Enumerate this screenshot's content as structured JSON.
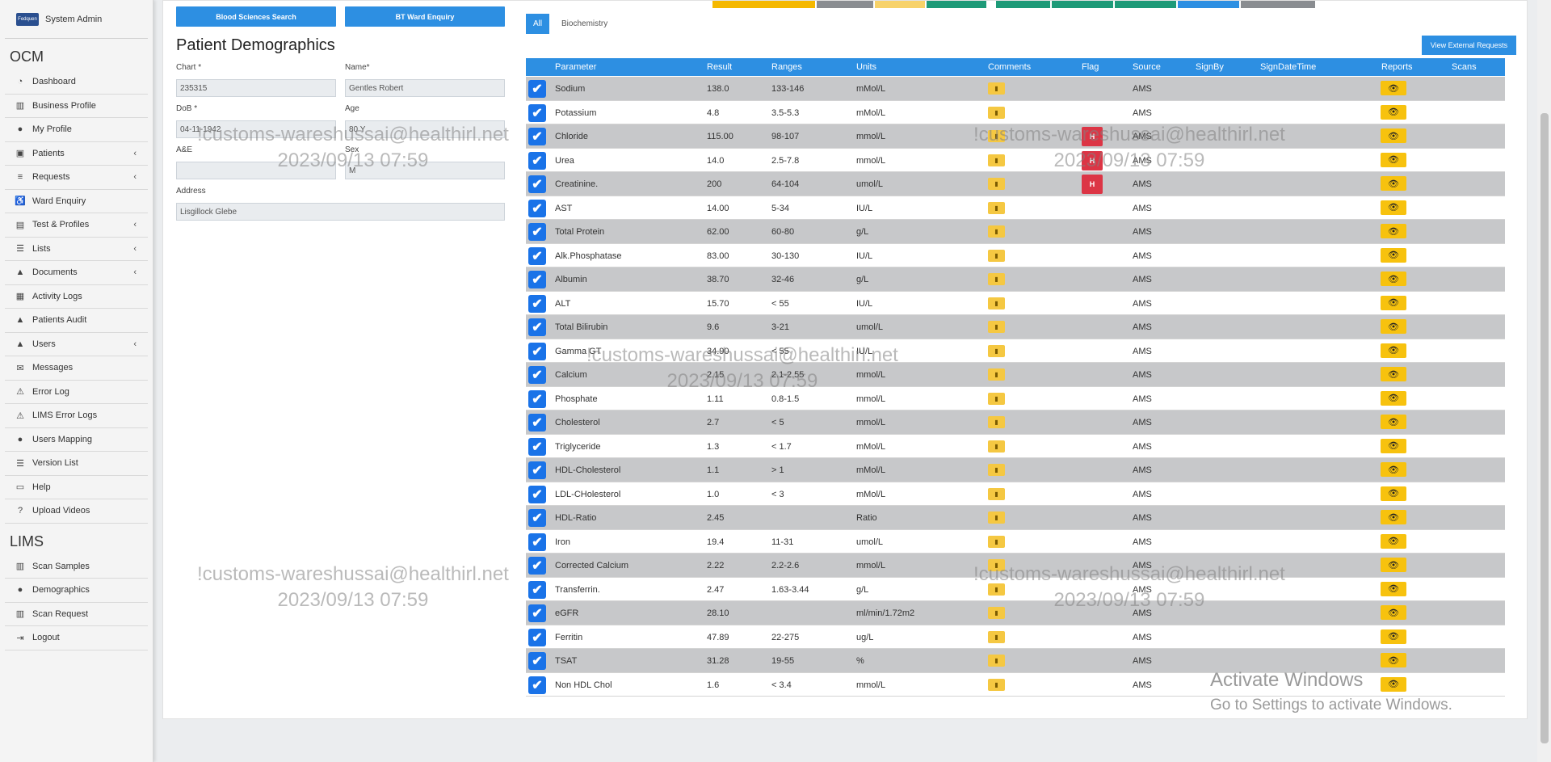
{
  "sidebar": {
    "user": "System Admin",
    "logo_text": "Fedquen",
    "sections": [
      {
        "title": "OCM",
        "items": [
          {
            "label": "Dashboard",
            "icon": "◔",
            "chevron": false
          },
          {
            "label": "Business Profile",
            "icon": "▥",
            "chevron": false
          },
          {
            "label": "My Profile",
            "icon": "●",
            "chevron": false
          },
          {
            "label": "Patients",
            "icon": "▣",
            "chevron": true
          },
          {
            "label": "Requests",
            "icon": "≡",
            "chevron": true
          },
          {
            "label": "Ward Enquiry",
            "icon": "♿",
            "chevron": false
          },
          {
            "label": "Test & Profiles",
            "icon": "▤",
            "chevron": true
          },
          {
            "label": "Lists",
            "icon": "☰",
            "chevron": true
          },
          {
            "label": "Documents",
            "icon": "▲",
            "chevron": true
          },
          {
            "label": "Activity Logs",
            "icon": "▦",
            "chevron": false
          },
          {
            "label": "Patients Audit",
            "icon": "▲",
            "chevron": false
          },
          {
            "label": "Users",
            "icon": "▲",
            "chevron": true
          },
          {
            "label": "Messages",
            "icon": "✉",
            "chevron": false
          },
          {
            "label": "Error Log",
            "icon": "⚠",
            "chevron": false
          },
          {
            "label": "LIMS Error Logs",
            "icon": "⚠",
            "chevron": false
          },
          {
            "label": "Users Mapping",
            "icon": "●",
            "chevron": false
          },
          {
            "label": "Version List",
            "icon": "☰",
            "chevron": false
          },
          {
            "label": "Help",
            "icon": "▭",
            "chevron": false
          },
          {
            "label": "Upload Videos",
            "icon": "?",
            "chevron": false
          }
        ]
      },
      {
        "title": "LIMS",
        "items": [
          {
            "label": "Scan Samples",
            "icon": "▥",
            "chevron": false
          },
          {
            "label": "Demographics",
            "icon": "●",
            "chevron": false
          },
          {
            "label": "Scan Request",
            "icon": "▥",
            "chevron": false
          },
          {
            "label": "Logout",
            "icon": "⇥",
            "chevron": false
          }
        ]
      }
    ]
  },
  "buttons": {
    "blood_sciences": "Blood Sciences Search",
    "bt_ward": "BT Ward Enquiry",
    "view_external": "View External Requests"
  },
  "demographics": {
    "title": "Patient Demographics",
    "chart_label": "Chart *",
    "chart_value": "235315",
    "name_label": "Name*",
    "name_value": "Gentles Robert",
    "dob_label": "DoB *",
    "dob_value": "04-11-1942",
    "age_label": "Age",
    "age_value": "80 Y",
    "ae_label": "A&E",
    "ae_value": "",
    "sex_label": "Sex",
    "sex_value": "M",
    "address_label": "Address",
    "address_value": "Lisgillock Glebe"
  },
  "tabs": [
    "All",
    "Biochemistry"
  ],
  "strip_colors": [
    "#f5b800",
    "#8a8d91",
    "#f7d26a",
    "#1e9a78",
    "#1e9a78",
    "#1e9a78",
    "#1e9a78",
    "#2d8fe2",
    "#8a8d91"
  ],
  "table": {
    "headers": [
      "Parameter",
      "Result",
      "Ranges",
      "Units",
      "Comments",
      "Flag",
      "Source",
      "SignBy",
      "SignDateTime",
      "Reports",
      "Scans"
    ],
    "rows": [
      {
        "param": "Sodium",
        "result": "138.0",
        "range": "133-146",
        "units": "mMol/L",
        "flag": "",
        "source": "AMS"
      },
      {
        "param": "Potassium",
        "result": "4.8",
        "range": "3.5-5.3",
        "units": "mMol/L",
        "flag": "",
        "source": "AMS"
      },
      {
        "param": "Chloride",
        "result": "115.00",
        "range": "98-107",
        "units": "mmol/L",
        "flag": "H",
        "source": "AMS"
      },
      {
        "param": "Urea",
        "result": "14.0",
        "range": "2.5-7.8",
        "units": "mmol/L",
        "flag": "H",
        "source": "AMS"
      },
      {
        "param": "Creatinine.",
        "result": "200",
        "range": "64-104",
        "units": "umol/L",
        "flag": "H",
        "source": "AMS"
      },
      {
        "param": "AST",
        "result": "14.00",
        "range": "5-34",
        "units": "IU/L",
        "flag": "",
        "source": "AMS"
      },
      {
        "param": "Total Protein",
        "result": "62.00",
        "range": "60-80",
        "units": "g/L",
        "flag": "",
        "source": "AMS"
      },
      {
        "param": "Alk.Phosphatase",
        "result": "83.00",
        "range": "30-130",
        "units": "IU/L",
        "flag": "",
        "source": "AMS"
      },
      {
        "param": "Albumin",
        "result": "38.70",
        "range": "32-46",
        "units": "g/L",
        "flag": "",
        "source": "AMS"
      },
      {
        "param": "ALT",
        "result": "15.70",
        "range": "< 55",
        "units": "IU/L",
        "flag": "",
        "source": "AMS"
      },
      {
        "param": "Total Bilirubin",
        "result": "9.6",
        "range": "3-21",
        "units": "umol/L",
        "flag": "",
        "source": "AMS"
      },
      {
        "param": "Gamma GT",
        "result": "34.90",
        "range": "< 55",
        "units": "IU/L",
        "flag": "",
        "source": "AMS"
      },
      {
        "param": "Calcium",
        "result": "2.15",
        "range": "2.1-2.55",
        "units": "mmol/L",
        "flag": "",
        "source": "AMS"
      },
      {
        "param": "Phosphate",
        "result": "1.11",
        "range": "0.8-1.5",
        "units": "mmol/L",
        "flag": "",
        "source": "AMS"
      },
      {
        "param": "Cholesterol",
        "result": "2.7",
        "range": "< 5",
        "units": "mmol/L",
        "flag": "",
        "source": "AMS"
      },
      {
        "param": "Triglyceride",
        "result": "1.3",
        "range": "< 1.7",
        "units": "mMol/L",
        "flag": "",
        "source": "AMS"
      },
      {
        "param": "HDL-Cholesterol",
        "result": "1.1",
        "range": "> 1",
        "units": "mMol/L",
        "flag": "",
        "source": "AMS"
      },
      {
        "param": "LDL-CHolesterol",
        "result": "1.0",
        "range": "< 3",
        "units": "mMol/L",
        "flag": "",
        "source": "AMS"
      },
      {
        "param": "HDL-Ratio",
        "result": "2.45",
        "range": "",
        "units": "Ratio",
        "flag": "",
        "source": "AMS"
      },
      {
        "param": "Iron",
        "result": "19.4",
        "range": "11-31",
        "units": "umol/L",
        "flag": "",
        "source": "AMS"
      },
      {
        "param": "Corrected Calcium",
        "result": "2.22",
        "range": "2.2-2.6",
        "units": "mmol/L",
        "flag": "",
        "source": "AMS"
      },
      {
        "param": "Transferrin.",
        "result": "2.47",
        "range": "1.63-3.44",
        "units": "g/L",
        "flag": "",
        "source": "AMS"
      },
      {
        "param": "eGFR",
        "result": "28.10",
        "range": "",
        "units": "ml/min/1.72m2",
        "flag": "",
        "source": "AMS"
      },
      {
        "param": "Ferritin",
        "result": "47.89",
        "range": "22-275",
        "units": "ug/L",
        "flag": "",
        "source": "AMS"
      },
      {
        "param": "TSAT",
        "result": "31.28",
        "range": "19-55",
        "units": "%",
        "flag": "",
        "source": "AMS"
      },
      {
        "param": "Non HDL Chol",
        "result": "1.6",
        "range": "< 3.4",
        "units": "mmol/L",
        "flag": "",
        "source": "AMS"
      }
    ]
  },
  "watermark": {
    "line1": "!customs-wareshussai@healthirl.net",
    "line2": "2023/09/13 07:59"
  },
  "windows_activation": {
    "line1": "Activate Windows",
    "line2": "Go to Settings to activate Windows."
  }
}
